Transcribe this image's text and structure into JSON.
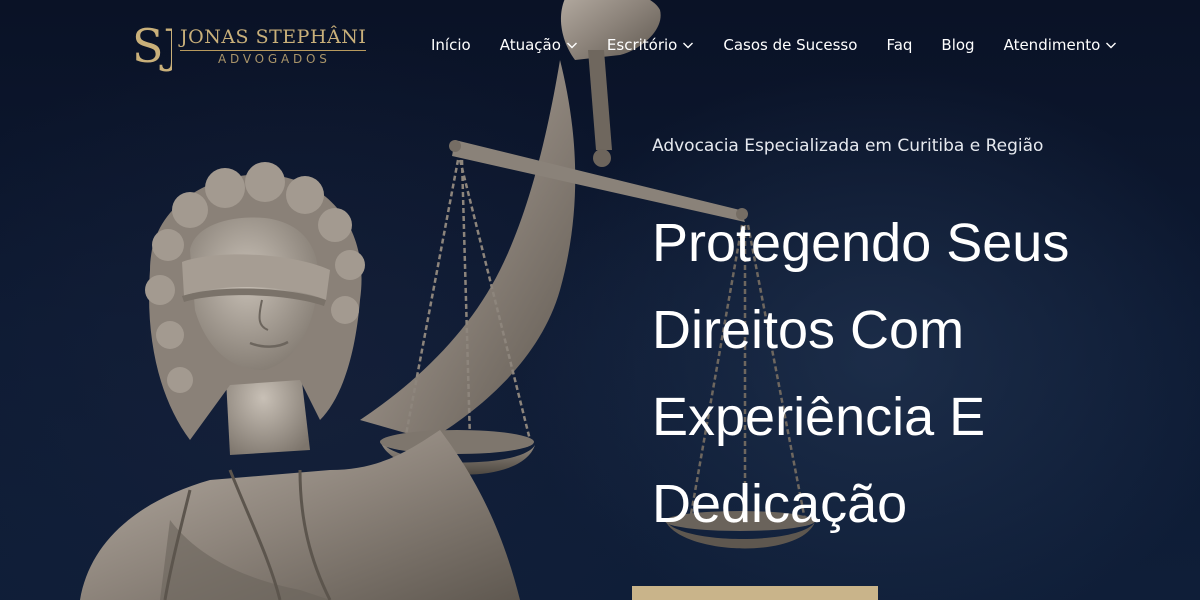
{
  "brand": {
    "monogram": "SJ",
    "name": "JONAS STEPHÂNI",
    "subtitle": "ADVOGADOS",
    "gold": "#c9b07a"
  },
  "nav": {
    "items": [
      {
        "label": "Início",
        "dropdown": false
      },
      {
        "label": "Atuação",
        "dropdown": true
      },
      {
        "label": "Escritório",
        "dropdown": true
      },
      {
        "label": "Casos de Sucesso",
        "dropdown": false
      },
      {
        "label": "Faq",
        "dropdown": false
      },
      {
        "label": "Blog",
        "dropdown": false
      },
      {
        "label": "Atendimento",
        "dropdown": true
      }
    ]
  },
  "hero": {
    "tagline": "Advocacia Especializada em Curitiba e Região",
    "headline_lines": [
      "Protegendo Seus",
      "Direitos Com",
      "Experiência E",
      "Dedicação"
    ],
    "background_color": "#0b1428",
    "cta_color": "#c9b48a"
  },
  "icons": {
    "dropdown": "chevron-down-icon",
    "hero_image": "lady-justice-statue"
  }
}
